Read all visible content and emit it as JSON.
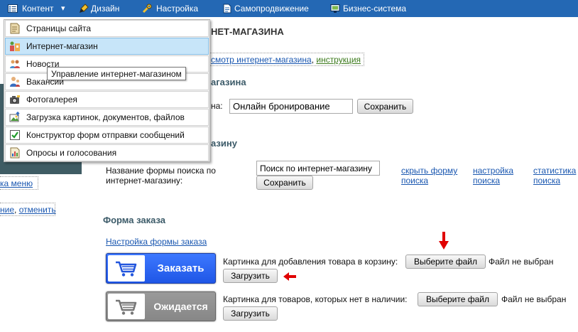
{
  "nav": {
    "items": [
      {
        "label": "Контент",
        "icon": "list-icon"
      },
      {
        "label": "Дизайн",
        "icon": "brush-icon"
      },
      {
        "label": "Настройка",
        "icon": "tools-icon"
      },
      {
        "label": "Самопродвижение",
        "icon": "document-icon"
      },
      {
        "label": "Бизнес-система",
        "icon": "monitor-icon"
      }
    ],
    "dropdown_arrow": "▾"
  },
  "content_menu": {
    "items": [
      {
        "label": "Страницы сайта",
        "icon": "page-icon",
        "active": false
      },
      {
        "label": "Интернет-магазин",
        "icon": "shop-icon",
        "active": true
      },
      {
        "label": "Новости",
        "icon": "news-icon",
        "active": false
      },
      {
        "label": "Вакансии",
        "icon": "people-icon",
        "active": false
      },
      {
        "label": "Фотогалерея",
        "icon": "camera-icon",
        "active": false
      },
      {
        "label": "Загрузка картинок, документов, файлов",
        "icon": "upload-icon",
        "active": false
      },
      {
        "label": "Конструктор форм отправки сообщений",
        "icon": "checkbox-icon",
        "active": false
      },
      {
        "label": "Опросы и голосования",
        "icon": "poll-icon",
        "active": false
      }
    ],
    "tooltip": "Управление интернет-магазином"
  },
  "sidebar": {
    "hide_menu_link": "ка меню",
    "undo_prefix": "ние",
    "undo_separator": ", ",
    "undo_link": "отменить"
  },
  "main": {
    "title": "НЕТ-МАГАЗИНА",
    "links": {
      "preview": "смотр интернет-магазина",
      "separator": ", ",
      "instruction": "инструкция"
    },
    "shop_name": {
      "heading": "агазина",
      "label": "на:",
      "value": "Онлайн бронирование",
      "save_button": "Сохранить"
    },
    "search_form": {
      "heading": "азину",
      "label": "Название формы поиска по интернет-магазину:",
      "value": "Поиск по интернет-магазину",
      "save_button": "Сохранить",
      "hide_link": "скрыть форму поиска",
      "settings_link": "настройка поиска",
      "stats_link": "статистика поиска"
    },
    "order_form": {
      "heading": "Форма заказа",
      "settings_link": "Настройка формы заказа",
      "images": [
        {
          "preview_text": "Заказать",
          "icon": "cart-icon",
          "label": "Картинка для добавления товара в корзину:",
          "file_button": "Выберите файл",
          "file_status": "Файл не выбран",
          "upload_button": "Загрузить"
        },
        {
          "preview_text": "Ожидается",
          "icon": "cart-icon",
          "label": "Картинка для товаров, которых нет в наличии:",
          "file_button": "Выберите файл",
          "file_status": "Файл не выбран",
          "upload_button": "Загрузить"
        }
      ]
    }
  },
  "annotations": {
    "arrows": [
      "arrow-down-icon",
      "arrow-left-icon"
    ]
  },
  "colors": {
    "nav_bg": "#2468b4",
    "link": "#1a57b0",
    "instruction_link": "#3c7a1c",
    "section_heading": "#3b5a68",
    "sidebar_bg": "#3f5c64",
    "menu_active_bg": "#c7e5f9",
    "order_button_bg": "#1f56e6",
    "waiting_button_bg": "#878787",
    "arrow": "#e00000"
  }
}
